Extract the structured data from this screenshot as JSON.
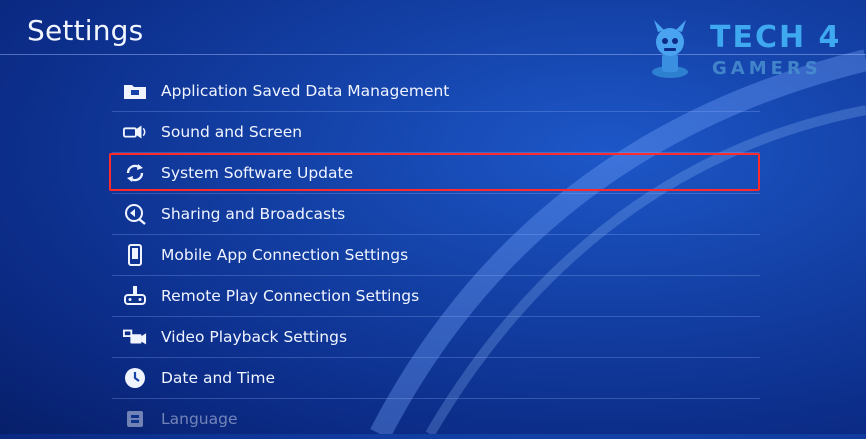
{
  "header": {
    "title": "Settings"
  },
  "watermark": {
    "line1": "TECH 4",
    "line2": "GAMERS"
  },
  "menu": {
    "items": [
      {
        "label": "Application Saved Data Management",
        "icon": "folder-icon"
      },
      {
        "label": "Sound and Screen",
        "icon": "speaker-icon"
      },
      {
        "label": "System Software Update",
        "icon": "refresh-icon",
        "highlighted": true
      },
      {
        "label": "Sharing and Broadcasts",
        "icon": "share-broadcast-icon"
      },
      {
        "label": "Mobile App Connection Settings",
        "icon": "smartphone-icon"
      },
      {
        "label": "Remote Play Connection Settings",
        "icon": "remote-play-icon"
      },
      {
        "label": "Video Playback Settings",
        "icon": "video-camera-icon"
      },
      {
        "label": "Date and Time",
        "icon": "clock-icon"
      },
      {
        "label": "Language",
        "icon": "language-icon"
      }
    ]
  },
  "colors": {
    "highlight_border": "#ff2a2a",
    "background": "#1442a8"
  }
}
